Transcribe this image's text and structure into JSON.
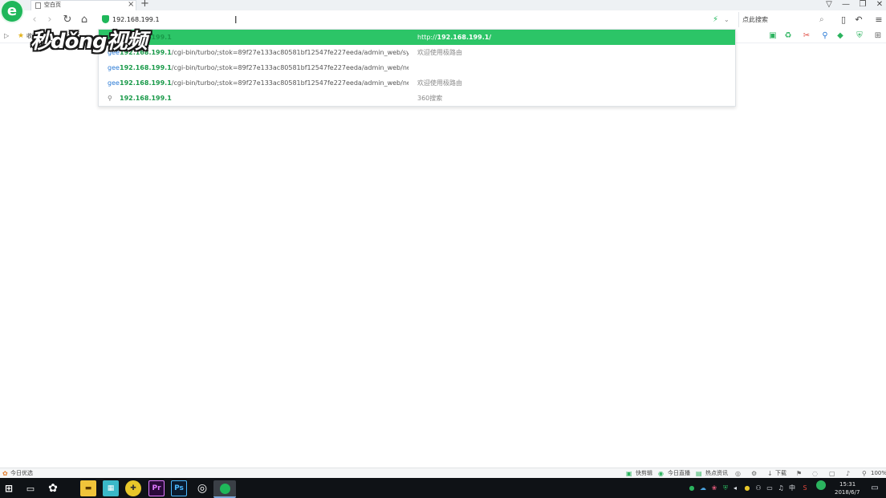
{
  "tab": {
    "title": "空白页",
    "close_icon": "close-icon",
    "new_tab_label": "+"
  },
  "window_controls": {
    "skin": "⌂",
    "minimize": "—",
    "restore": "❐",
    "close": "✕"
  },
  "toolbar": {
    "back": "‹",
    "forward": "›",
    "refresh": "↻",
    "home": "⌂",
    "address_value": "192.168.199.1",
    "search_placeholder": "点此搜索"
  },
  "bookmarks": {
    "label": "收藏"
  },
  "watermark": "秒dǒng视频",
  "suggestions": [
    {
      "icon": "",
      "url_bold": "192.168.199.1",
      "url_rest": "",
      "desc_prefix": "http://",
      "desc_bold": "192.168.199.1/",
      "selected": true
    },
    {
      "icon": "gee",
      "url_bold": "192.168.199.1",
      "url_rest": "/cgi-bin/turbo/;stok=89f27e133ac80581bf12547fe227eeda/admin_web/system",
      "desc_prefix": "欢迎使用极路由",
      "desc_bold": "",
      "selected": false
    },
    {
      "icon": "gee",
      "url_bold": "192.168.199.1",
      "url_rest": "/cgi-bin/turbo/;stok=89f27e133ac80581bf12547fe227eeda/admin_web/network",
      "desc_prefix": "",
      "desc_bold": "",
      "selected": false
    },
    {
      "icon": "gee",
      "url_bold": "192.168.199.1",
      "url_rest": "/cgi-bin/turbo/;stok=89f27e133ac80581bf12547fe227eeda/admin_web/network",
      "desc_prefix": "欢迎使用极路由",
      "desc_bold": "",
      "selected": false
    },
    {
      "icon": "🔍",
      "url_bold": "192.168.199.1",
      "url_rest": "",
      "desc_prefix": "360搜索",
      "desc_bold": "",
      "selected": false
    }
  ],
  "statusbar": {
    "left": "今日优选",
    "items": [
      "快剪辑",
      "今日直播",
      "热点资讯",
      "下载",
      "100%"
    ]
  },
  "taskbar": {
    "time": "15:31",
    "date": "2018/6/7",
    "ime": "中",
    "apps": [
      "Pr",
      "Ps"
    ]
  },
  "colors": {
    "brand_green": "#1fb75a",
    "selected_row": "#2cc567",
    "taskbar": "#0f1216"
  }
}
